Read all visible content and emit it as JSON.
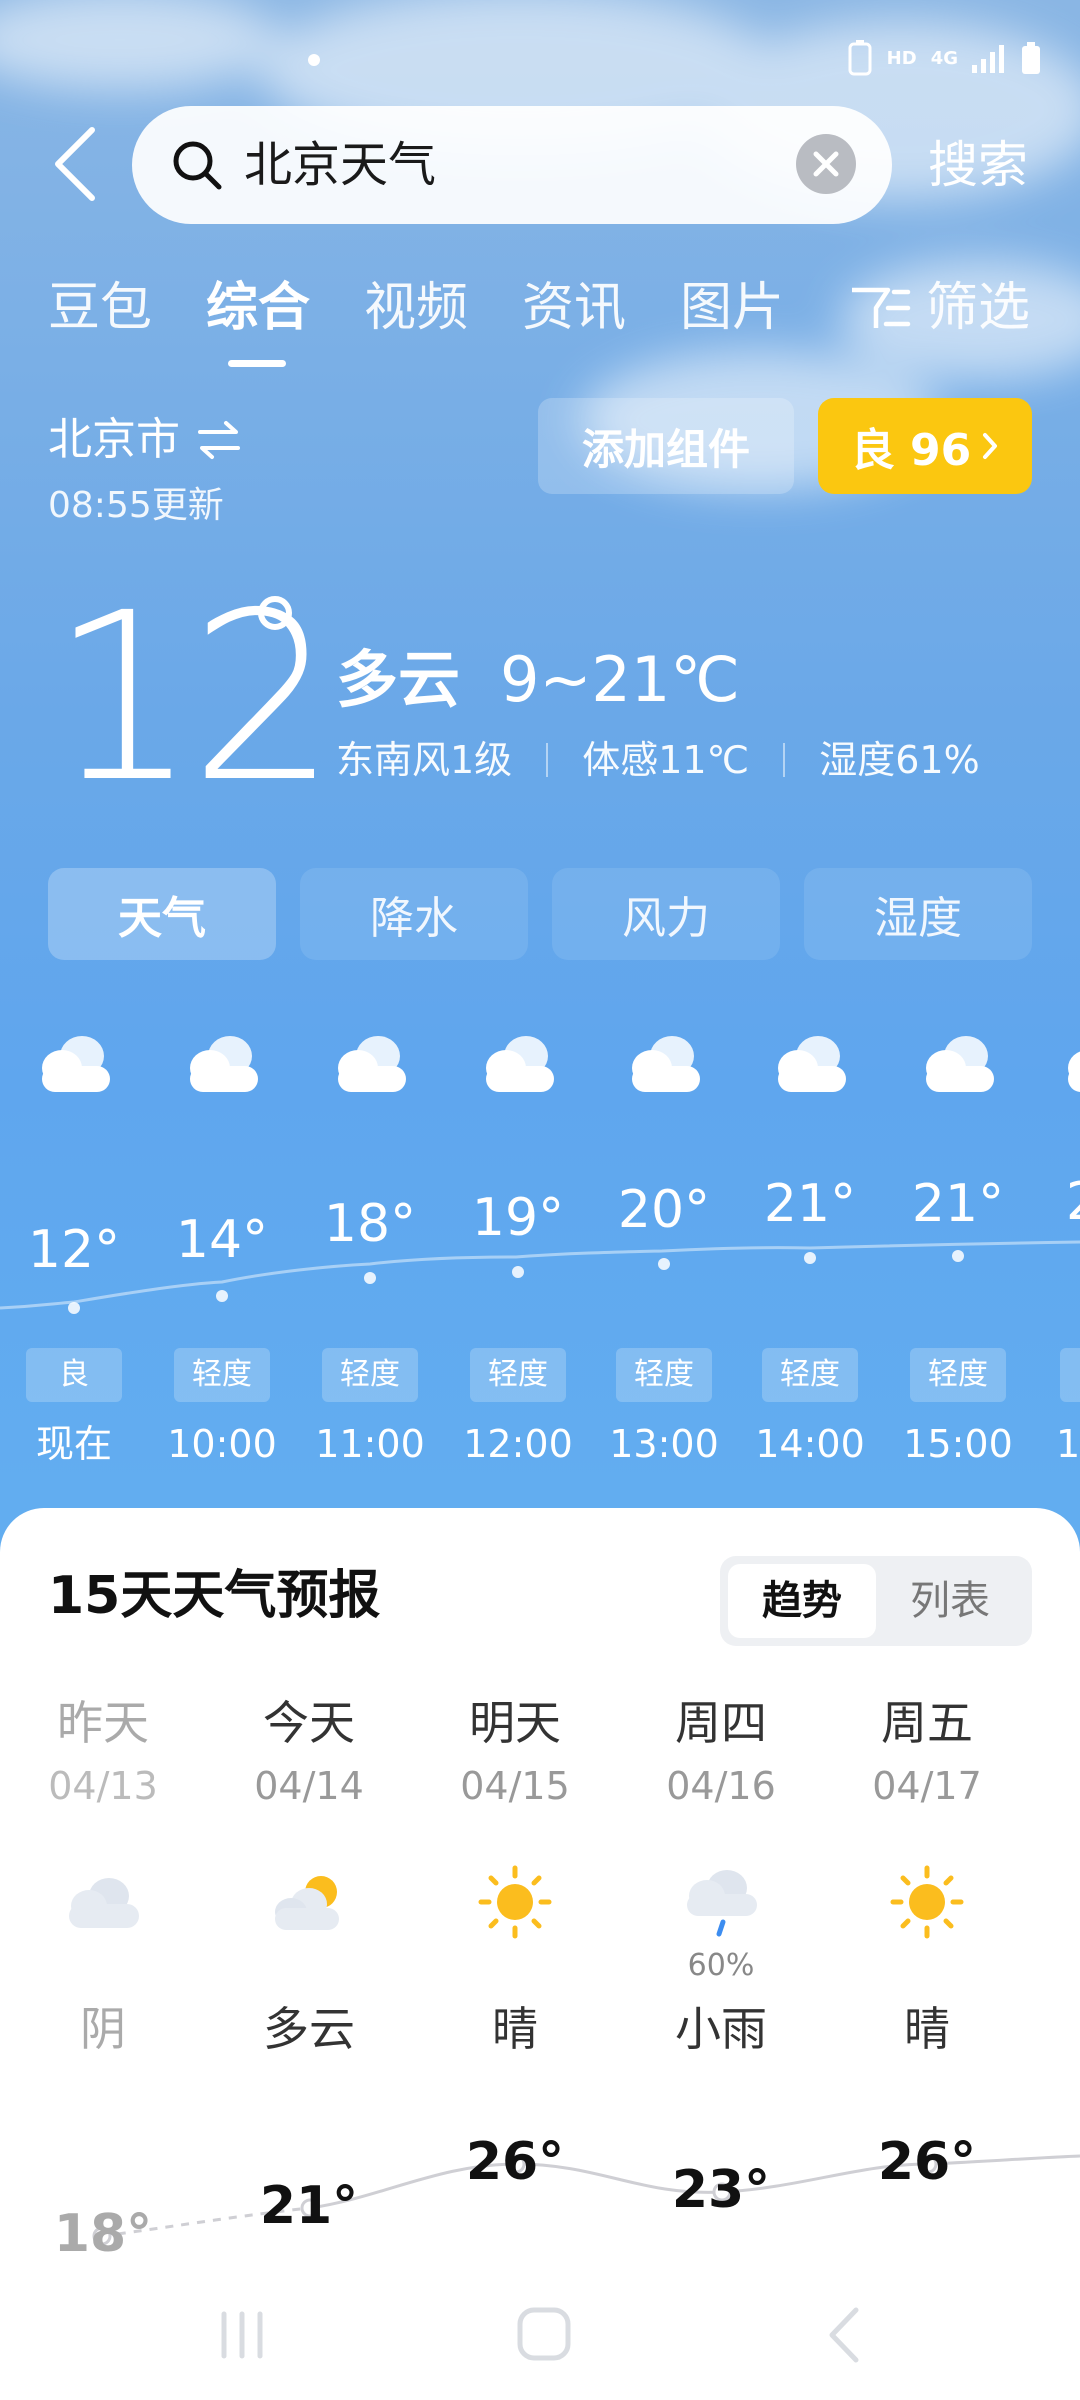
{
  "search": {
    "query": "北京天气",
    "button": "搜索"
  },
  "tabs": [
    "豆包",
    "综合",
    "视频",
    "资讯",
    "图片",
    "筛选"
  ],
  "location": {
    "city": "北京市",
    "updated": "08:55更新"
  },
  "actions": {
    "add_widget": "添加组件",
    "aqi": "良 96"
  },
  "current": {
    "temp": "12",
    "condition": "多云",
    "range": "9~21℃",
    "wind": "东南风1级",
    "feels": "体感11℃",
    "humidity": "湿度61%"
  },
  "sub_tabs": [
    "天气",
    "降水",
    "风力",
    "湿度"
  ],
  "hourly": [
    {
      "time": "现在",
      "temp": "12°",
      "aqi": "良",
      "icon": "cloud-icon"
    },
    {
      "time": "10:00",
      "temp": "14°",
      "aqi": "轻度",
      "icon": "cloud-icon"
    },
    {
      "time": "11:00",
      "temp": "18°",
      "aqi": "轻度",
      "icon": "cloud-icon"
    },
    {
      "time": "12:00",
      "temp": "19°",
      "aqi": "轻度",
      "icon": "cloud-icon"
    },
    {
      "time": "13:00",
      "temp": "20°",
      "aqi": "轻度",
      "icon": "cloud-icon"
    },
    {
      "time": "14:00",
      "temp": "21°",
      "aqi": "轻度",
      "icon": "cloud-icon"
    },
    {
      "time": "15:00",
      "temp": "21°",
      "aqi": "轻度",
      "icon": "cloud-icon"
    },
    {
      "time": "1",
      "temp": "2",
      "aqi": "",
      "icon": "cloud-icon"
    }
  ],
  "forecast": {
    "title": "15天天气预报",
    "toggle": [
      "趋势",
      "列表"
    ],
    "days": [
      {
        "name": "昨天",
        "date": "04/13",
        "cond": "阴",
        "temp": "18°",
        "icon": "overcast-icon",
        "prob": ""
      },
      {
        "name": "今天",
        "date": "04/14",
        "cond": "多云",
        "temp": "21°",
        "icon": "partly-cloudy-icon",
        "prob": ""
      },
      {
        "name": "明天",
        "date": "04/15",
        "cond": "晴",
        "temp": "26°",
        "icon": "sun-icon",
        "prob": ""
      },
      {
        "name": "周四",
        "date": "04/16",
        "cond": "小雨",
        "temp": "23°",
        "icon": "rain-icon",
        "prob": "60%"
      },
      {
        "name": "周五",
        "date": "04/17",
        "cond": "晴",
        "temp": "26°",
        "icon": "sun-icon",
        "prob": ""
      }
    ]
  },
  "colors": {
    "aqi_good": "#fbc710",
    "sky_top": "#8ab6e4",
    "sky_bottom": "#67b1f0"
  }
}
